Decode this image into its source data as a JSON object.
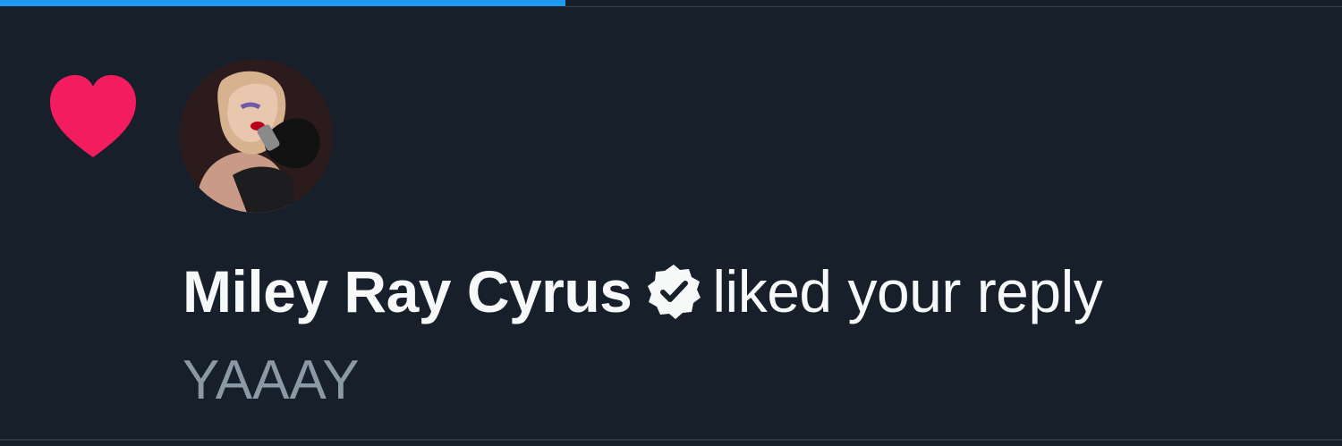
{
  "notification": {
    "icon": "heart-icon",
    "user_name": "Miley Ray Cyrus",
    "verified_icon": "verified-badge-icon",
    "action": "liked your reply",
    "reply_text": "YAAAY"
  },
  "colors": {
    "background": "#161f2a",
    "heart": "#f91880",
    "tab_indicator": "#1d9bf0",
    "primary_text": "#f7f9f9",
    "secondary_text": "#8b98a5"
  }
}
